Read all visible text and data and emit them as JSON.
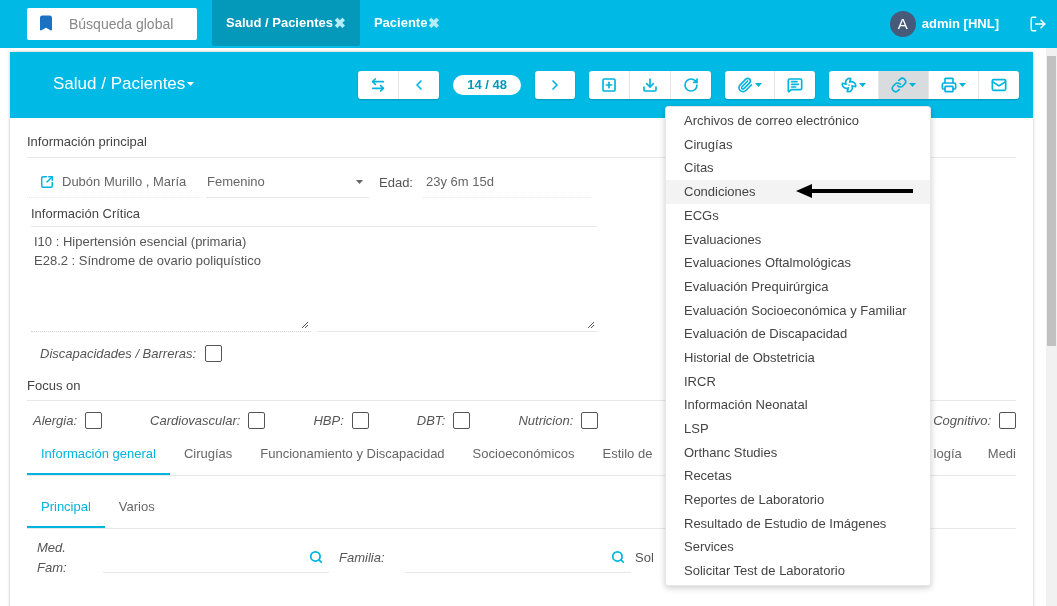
{
  "topbar": {
    "search": {
      "placeholder": "Búsqueda global"
    },
    "tabs": [
      {
        "label": "Salud / Pacientes",
        "close": "✖",
        "selected": true
      },
      {
        "label": "Paciente",
        "close": "✖",
        "selected": false
      }
    ],
    "user": {
      "avatar": "A",
      "name": "admin [HNL]"
    }
  },
  "header": {
    "title": "Salud / Pacientes",
    "counter": "14 / 48",
    "buttons": [
      {
        "caret": false,
        "pressed": false
      },
      {
        "caret": false,
        "pressed": false
      },
      {
        "caret": false,
        "pressed": false
      },
      {
        "caret": false,
        "pressed": false
      },
      {
        "caret": false,
        "pressed": false
      },
      {
        "caret": false,
        "pressed": false
      },
      {
        "caret": true,
        "pressed": false
      },
      {
        "caret": false,
        "pressed": false
      },
      {
        "caret": true,
        "pressed": false
      },
      {
        "caret": true,
        "pressed": true
      },
      {
        "caret": true,
        "pressed": false
      },
      {
        "caret": false,
        "pressed": false
      }
    ]
  },
  "main_info": {
    "title": "Información principal",
    "name": "Dubón Murillo , María",
    "sex": "Femenino",
    "age_label": "Edad:",
    "age": "23y 6m 15d"
  },
  "critical": {
    "title": "Información Crítica",
    "lines": [
      "I10 : Hipertensión esencial (primaria)",
      "E28.2 : Síndrome de ovario poliquístico"
    ]
  },
  "disabilities": {
    "label": "Discapacidades / Barreras:",
    "checked": false
  },
  "focus": {
    "title": "Focus on",
    "items": [
      {
        "label": "Alergia:",
        "checked": false
      },
      {
        "label": "Cardiovascular:",
        "checked": false
      },
      {
        "label": "HBP:",
        "checked": false
      },
      {
        "label": "DBT:",
        "checked": false
      },
      {
        "label": "Nutricion:",
        "checked": false
      }
    ],
    "right_items": [
      {
        "label": "Cognitivo:",
        "checked": false
      }
    ]
  },
  "tabs": [
    {
      "label": "Información general",
      "selected": true
    },
    {
      "label": "Cirugías",
      "selected": false
    },
    {
      "label": "Funcionamiento y Discapacidad",
      "selected": false
    },
    {
      "label": "Socioeconómicos",
      "selected": false
    },
    {
      "label": "Estilo de",
      "selected": false
    }
  ],
  "right_tabs": [
    {
      "label": "logía",
      "selected": false
    },
    {
      "label": "Medi",
      "selected": false
    }
  ],
  "subtabs": [
    {
      "label": "Principal",
      "selected": true
    },
    {
      "label": "Varios",
      "selected": false
    }
  ],
  "fields": [
    {
      "label": "Med. Fam:"
    },
    {
      "label": "Familia:"
    }
  ],
  "cut_field_label": "Sol",
  "menu": {
    "items": [
      {
        "label": "Archivos de correo electrónico",
        "selected": false
      },
      {
        "label": "Cirugías",
        "selected": false
      },
      {
        "label": "Citas",
        "selected": false
      },
      {
        "label": "Condiciones",
        "selected": true
      },
      {
        "label": "ECGs",
        "selected": false
      },
      {
        "label": "Evaluaciones",
        "selected": false
      },
      {
        "label": "Evaluaciones Oftalmológicas",
        "selected": false
      },
      {
        "label": "Evaluación Prequirúrgica",
        "selected": false
      },
      {
        "label": "Evaluación Socioeconómica y Familiar",
        "selected": false
      },
      {
        "label": "Evaluación de Discapacidad",
        "selected": false
      },
      {
        "label": "Historial de Obstetricia",
        "selected": false
      },
      {
        "label": "IRCR",
        "selected": false
      },
      {
        "label": "Información Neonatal",
        "selected": false
      },
      {
        "label": "LSP",
        "selected": false
      },
      {
        "label": "Orthanc Studies",
        "selected": false
      },
      {
        "label": "Recetas",
        "selected": false
      },
      {
        "label": "Reportes de Laboratorio",
        "selected": false
      },
      {
        "label": "Resultado de Estudio de Imágenes",
        "selected": false
      },
      {
        "label": "Services",
        "selected": false
      },
      {
        "label": "Solicitar Test de Laboratorio",
        "selected": false
      }
    ]
  }
}
